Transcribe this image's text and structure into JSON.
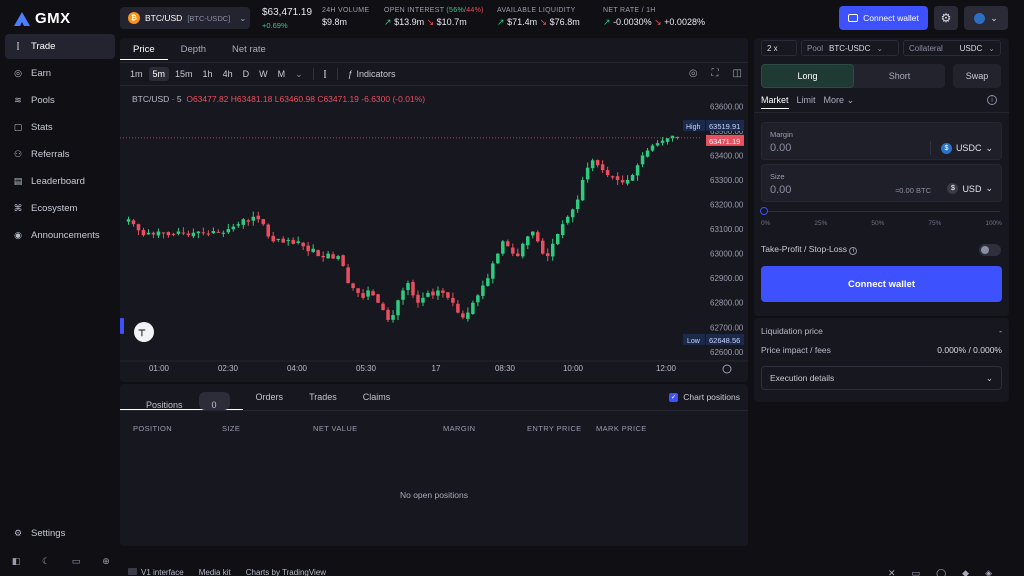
{
  "app": {
    "name": "GMX"
  },
  "sidebar": {
    "items": [
      {
        "label": "Trade",
        "icon": "candles-icon"
      },
      {
        "label": "Earn",
        "icon": "coins-icon"
      },
      {
        "label": "Pools",
        "icon": "database-icon"
      },
      {
        "label": "Stats",
        "icon": "chart-icon"
      },
      {
        "label": "Referrals",
        "icon": "users-icon"
      },
      {
        "label": "Leaderboard",
        "icon": "leaderboard-icon"
      },
      {
        "label": "Ecosystem",
        "icon": "ecosystem-icon"
      },
      {
        "label": "Announcements",
        "icon": "announcement-icon"
      }
    ],
    "settings": "Settings"
  },
  "header": {
    "market": "BTC/USD",
    "market_sub": "[BTC-USDC]",
    "price": "$63,471.19",
    "change": "+0.69%",
    "volume_label": "24H VOLUME",
    "volume": "$9.8m",
    "oi_label": "OPEN INTEREST",
    "oi_long_pct": "(56%",
    "oi_short_pct": "44%)",
    "oi_long": "$13.9m",
    "oi_short": "$10.7m",
    "liq_label": "AVAILABLE LIQUIDITY",
    "liq_long": "$71.4m",
    "liq_short": "$76.8m",
    "rate_label": "NET RATE / 1H",
    "rate_long": "-0.0030%",
    "rate_short": "+0.0028%",
    "connect": "Connect wallet"
  },
  "chart_tabs": [
    "Price",
    "Depth",
    "Net rate"
  ],
  "toolbar": {
    "intervals": [
      "1m",
      "5m",
      "15m",
      "1h",
      "4h",
      "D",
      "W",
      "M"
    ],
    "indicators": "Indicators"
  },
  "ohlc": {
    "symbol": "BTC/USD · 5",
    "o": "O63477.82",
    "h": "H63481.18",
    "l": "L63460.98",
    "c": "C63471.19",
    "chg": "-6.6300 (-0.01%)"
  },
  "chart_data": {
    "type": "candlestick",
    "title": "BTC/USD · 5",
    "x_ticks": [
      "01:00",
      "02:30",
      "04:00",
      "05:30",
      "17",
      "08:30",
      "10:00",
      "12:00"
    ],
    "y_ticks": [
      63600,
      63500,
      63400,
      63300,
      63200,
      63100,
      63000,
      62900,
      62800,
      62700,
      62600
    ],
    "ylim": [
      62575,
      63650
    ],
    "close_path": [
      63140,
      63120,
      63095,
      63075,
      63085,
      63078,
      63090,
      63082,
      63075,
      63080,
      63090,
      63085,
      63075,
      63085,
      63090,
      63085,
      63080,
      63092,
      63088,
      63085,
      63100,
      63110,
      63120,
      63140,
      63130,
      63150,
      63140,
      63120,
      63070,
      63050,
      63060,
      63045,
      63055,
      63040,
      63050,
      63030,
      63010,
      63020,
      62990,
      62985,
      63000,
      62980,
      62990,
      62950,
      62880,
      62860,
      62840,
      62820,
      62850,
      62830,
      62800,
      62770,
      62730,
      62750,
      62810,
      62850,
      62880,
      62830,
      62800,
      62820,
      62840,
      62830,
      62850,
      62840,
      62820,
      62800,
      62760,
      62740,
      62760,
      62800,
      62830,
      62870,
      62900,
      62960,
      63000,
      63050,
      63030,
      63000,
      62990,
      63040,
      63070,
      63090,
      63050,
      63000,
      62990,
      63040,
      63080,
      63120,
      63150,
      63180,
      63220,
      63300,
      63350,
      63380,
      63360,
      63340,
      63320,
      63310,
      63300,
      63290,
      63300,
      63320,
      63360,
      63400,
      63420,
      63440,
      63450,
      63460,
      63470,
      63480,
      63471
    ],
    "high_label": "High",
    "high": "63519.91",
    "low_label": "Low",
    "low": "62648.56",
    "last": "63471.19"
  },
  "positions": {
    "tabs": [
      "Positions",
      "Orders",
      "Trades",
      "Claims"
    ],
    "count": "0",
    "chart_positions": "Chart positions",
    "columns": [
      "POSITION",
      "SIZE",
      "NET VALUE",
      "MARGIN",
      "ENTRY PRICE",
      "MARK PRICE"
    ],
    "empty": "No open positions"
  },
  "trade": {
    "leverage": "2 x",
    "pool_label": "Pool",
    "pool": "BTC-USDC",
    "collateral_label": "Collateral",
    "collateral": "USDC",
    "sides": [
      "Long",
      "Short"
    ],
    "swap": "Swap",
    "order_types": [
      "Market",
      "Limit",
      "More"
    ],
    "margin_label": "Margin",
    "margin_value": "0.00",
    "margin_token": "USDC",
    "size_label": "Size",
    "size_value": "0.00",
    "size_btc": "≈0.00 BTC",
    "size_token": "USD",
    "percents": [
      "0%",
      "25%",
      "50%",
      "75%",
      "100%"
    ],
    "tpsl": "Take-Profit / Stop-Loss",
    "connect": "Connect wallet",
    "liq_label": "Liquidation price",
    "liq_value": "-",
    "impact_label": "Price impact / fees",
    "impact_value": "0.000% / 0.000%",
    "exec": "Execution details"
  },
  "footer": {
    "links": [
      "V1 interface",
      "Media kit",
      "Charts by TradingView"
    ]
  }
}
